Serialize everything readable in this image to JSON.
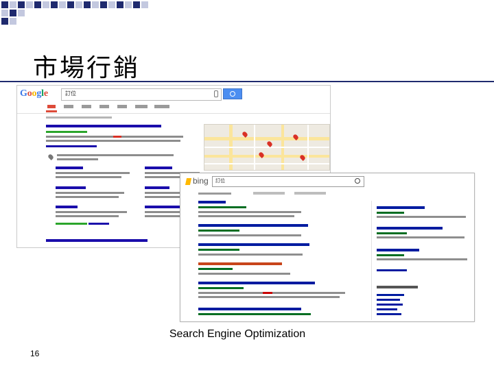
{
  "slide": {
    "title": "市場行銷",
    "caption": "Search Engine Optimization",
    "page_number": "16",
    "accent_color": "#1f2a6e"
  },
  "google_screenshot": {
    "logo_letters": [
      "G",
      "o",
      "o",
      "g",
      "l",
      "e"
    ],
    "logo_colors": [
      "#3b78e7",
      "#dd4b39",
      "#f5b400",
      "#3b78e7",
      "#0f9d58",
      "#dd4b39"
    ],
    "query": "訂位",
    "icons": [
      "microphone-icon",
      "search-icon",
      "map-pin-icon"
    ]
  },
  "bing_screenshot": {
    "logo": "bing",
    "query": "訂位",
    "icons": [
      "bing-logo-icon",
      "search-icon"
    ]
  }
}
